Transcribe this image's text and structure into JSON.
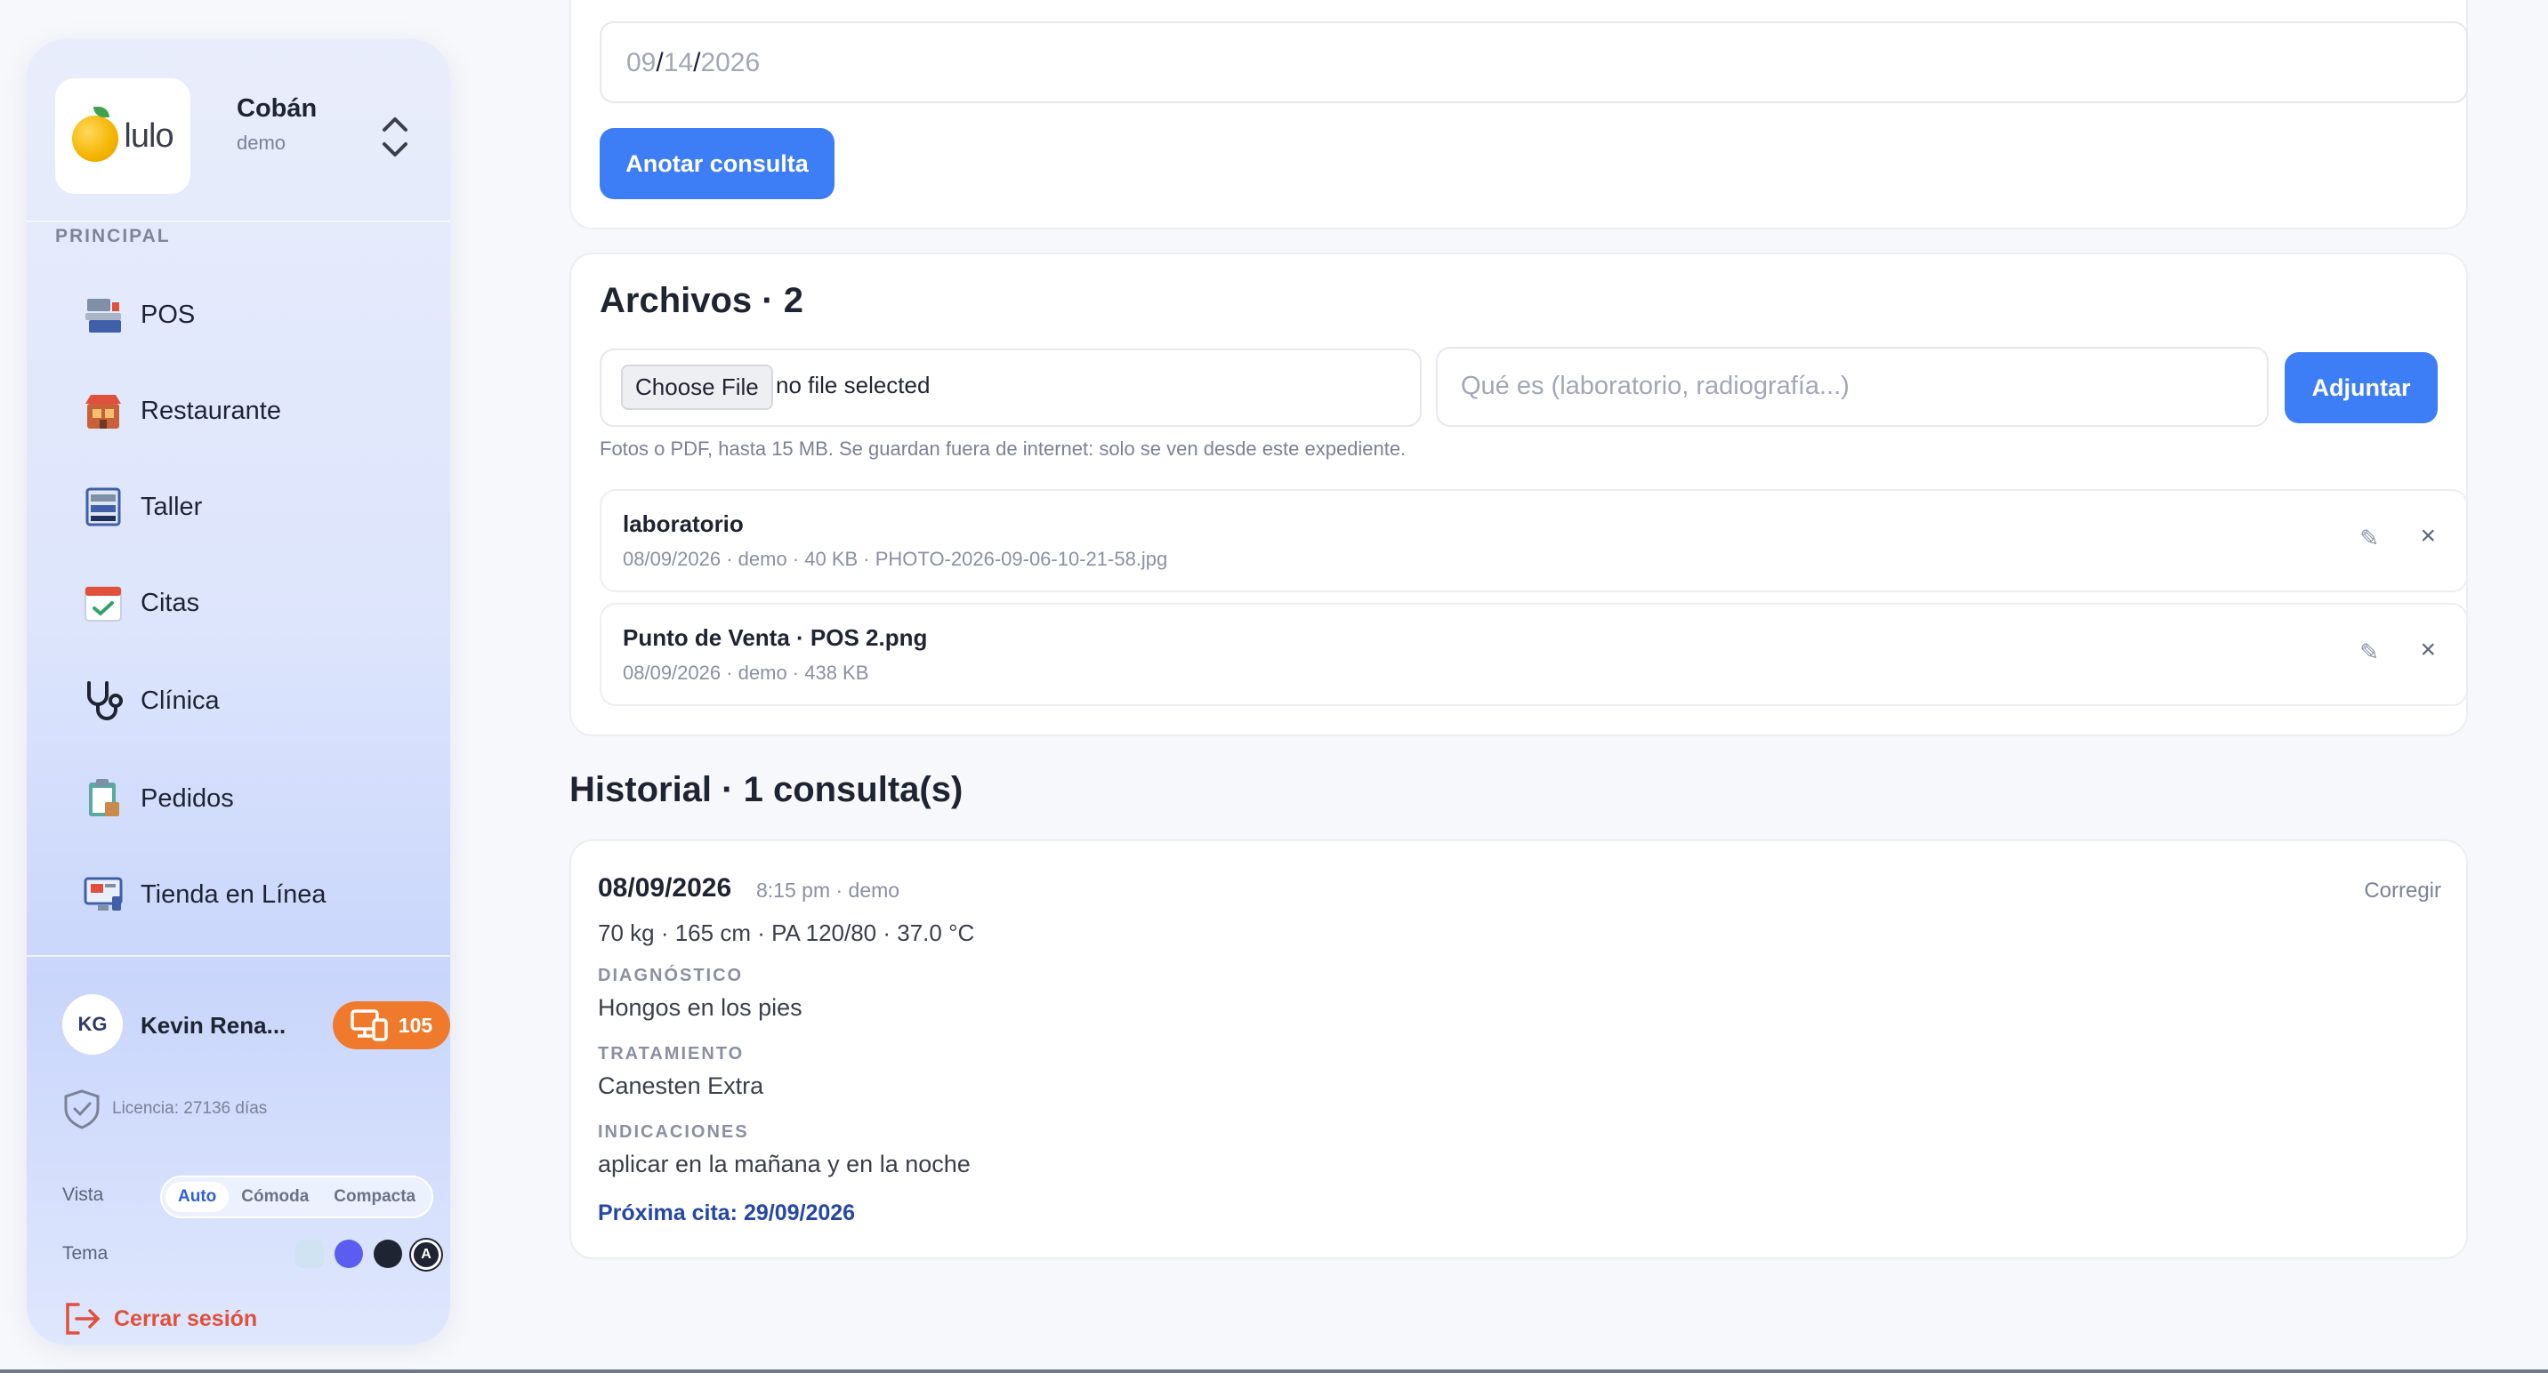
{
  "sidebar": {
    "brand": {
      "logo_text": "lulo",
      "name": "Cobán",
      "subtitle": "demo"
    },
    "section_label": "PRINCIPAL",
    "items": [
      {
        "label": "POS",
        "icon": "pos-terminal-icon"
      },
      {
        "label": "Restaurante",
        "icon": "restaurant-icon"
      },
      {
        "label": "Taller",
        "icon": "workshop-icon"
      },
      {
        "label": "Citas",
        "icon": "calendar-check-icon"
      },
      {
        "label": "Clínica",
        "icon": "stethoscope-icon"
      },
      {
        "label": "Pedidos",
        "icon": "clipboard-order-icon"
      },
      {
        "label": "Tienda en Línea",
        "icon": "online-store-icon"
      }
    ],
    "user": {
      "initials": "KG",
      "name": "Kevin Rena...",
      "badge_count": "105"
    },
    "license": "Licencia: 27136 días",
    "vista": {
      "label": "Vista",
      "options": [
        "Auto",
        "Cómoda",
        "Compacta"
      ],
      "selected": "Auto"
    },
    "tema": {
      "label": "Tema",
      "swatches": [
        "#cfe3f2",
        "#5b5cf0",
        "#1f2433",
        "#1f2433"
      ]
    },
    "logout": "Cerrar sesión",
    "accent": "#3d7ef7",
    "badge_color": "#f07a2b"
  },
  "consulta_form": {
    "date": {
      "month": "09",
      "day": "14",
      "year": "2026"
    },
    "submit": "Anotar consulta"
  },
  "archivos": {
    "title": "Archivos · 2",
    "choose_file": "Choose File",
    "no_file": "no file selected",
    "desc_placeholder": "Qué es (laboratorio, radiografía...)",
    "attach": "Adjuntar",
    "hint": "Fotos o PDF, hasta 15 MB. Se guardan fuera de internet: solo se ven desde este expediente.",
    "files": [
      {
        "title": "laboratorio",
        "meta": "08/09/2026 · demo · 40 KB · PHOTO-2026-09-06-10-21-58.jpg"
      },
      {
        "title": "Punto de Venta · POS 2.png",
        "meta": "08/09/2026 · demo · 438 KB"
      }
    ]
  },
  "historial": {
    "title": "Historial · 1 consulta(s)",
    "consultas": [
      {
        "date": "08/09/2026",
        "time": "8:15 pm · demo",
        "fix": "Corregir",
        "vitals": "70 kg · 165 cm · PA 120/80 · 37.0 °C",
        "diag_label": "DIAGNÓSTICO",
        "diag": "Hongos en los pies",
        "trat_label": "TRATAMIENTO",
        "trat": "Canesten Extra",
        "ind_label": "INDICACIONES",
        "ind": "aplicar en la mañana y en la noche",
        "next": "Próxima cita: 29/09/2026"
      }
    ]
  }
}
